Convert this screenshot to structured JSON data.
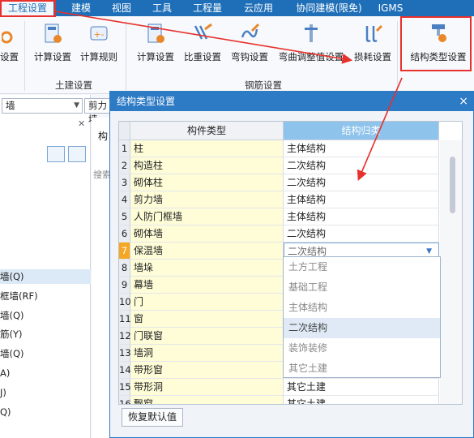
{
  "menu": {
    "items": [
      "工程设置",
      "建模",
      "视图",
      "工具",
      "工程量",
      "云应用",
      "协同建模(限免)",
      "IGMS"
    ],
    "active_index": 0
  },
  "ribbon": {
    "left_partial_label": "设置",
    "civil_buttons": [
      "计算设置",
      "计算规则"
    ],
    "rebar_buttons": [
      "计算设置",
      "比重设置",
      "弯钩设置",
      "弯曲调整值设置",
      "损耗设置"
    ],
    "struct_button": "结构类型设置",
    "groups": {
      "civil": "土建设置",
      "rebar": "钢筋设置"
    }
  },
  "left_panel": {
    "combo1": "墙",
    "combo2": "剪力墙",
    "mid_header": "构",
    "search_placeholder": "搜索",
    "tree_items": [
      "墙(Q)",
      "框墙(RF)",
      "墙(Q)",
      "筋(Y)",
      "墙(Q)",
      "A)",
      "J)",
      "Q)"
    ]
  },
  "dialog": {
    "title": "结构类型设置",
    "close": "×",
    "columns": [
      "构件类型",
      "结构归类"
    ],
    "rows": [
      {
        "num": "1",
        "type": "柱",
        "category": "主体结构"
      },
      {
        "num": "2",
        "type": "构造柱",
        "category": "二次结构"
      },
      {
        "num": "3",
        "type": "砌体柱",
        "category": "二次结构"
      },
      {
        "num": "4",
        "type": "剪力墙",
        "category": "主体结构"
      },
      {
        "num": "5",
        "type": "人防门框墙",
        "category": "主体结构"
      },
      {
        "num": "6",
        "type": "砌体墙",
        "category": "二次结构"
      },
      {
        "num": "7",
        "type": "保温墙",
        "category": "二次结构"
      },
      {
        "num": "8",
        "type": "墙垛",
        "category": ""
      },
      {
        "num": "9",
        "type": "幕墙",
        "category": ""
      },
      {
        "num": "10",
        "type": "门",
        "category": ""
      },
      {
        "num": "11",
        "type": "窗",
        "category": ""
      },
      {
        "num": "12",
        "type": "门联窗",
        "category": ""
      },
      {
        "num": "13",
        "type": "墙洞",
        "category": ""
      },
      {
        "num": "14",
        "type": "带形窗",
        "category": ""
      },
      {
        "num": "15",
        "type": "带形洞",
        "category": "其它土建"
      },
      {
        "num": "16",
        "type": "飘窗",
        "category": "其它土建"
      }
    ],
    "active_row": 7,
    "dropdown_options": [
      "土方工程",
      "基础工程",
      "主体结构",
      "二次结构",
      "装饰装修",
      "其它土建"
    ],
    "dropdown_selected": 3,
    "restore_button": "恢复默认值"
  },
  "colors": {
    "menubar": "#1e6fb8",
    "dialog_title": "#2d7ac5",
    "column_header_active": "#8ec3ec",
    "type_cell": "#fefdd8",
    "active_row_number": "#f5a623",
    "annotation_red": "#e8302c"
  },
  "icons": [
    "settings-icon",
    "calc-settings-icon",
    "calc-rules-icon",
    "weight-icon",
    "hook-icon",
    "bend-icon",
    "loss-icon",
    "structure-type-icon"
  ]
}
